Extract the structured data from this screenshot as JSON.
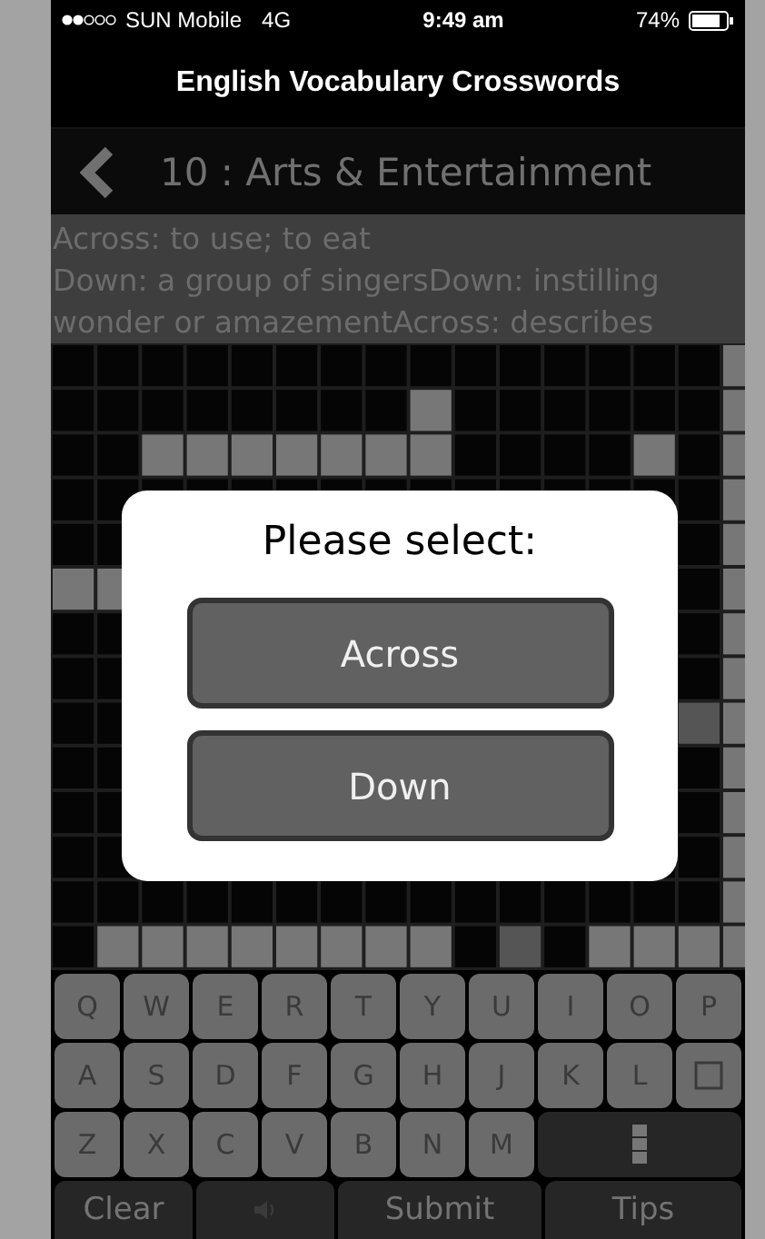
{
  "status_bar": {
    "carrier": "SUN Mobile",
    "network": "4G",
    "time": "9:49 am",
    "battery": "74%"
  },
  "app_title": "English Vocabulary Crosswords",
  "nav": {
    "title": "10 : Arts & Entertainment"
  },
  "clues": [
    "Across: to use; to eat",
    "Down: a group of singersDown: instilling wonder or amazementAcross: describes"
  ],
  "dialog": {
    "title": "Please select:",
    "options": [
      {
        "label": "Across"
      },
      {
        "label": "Down"
      }
    ]
  },
  "keyboard": {
    "rows": [
      [
        {
          "kind": "letter",
          "label": "Q"
        },
        {
          "kind": "letter",
          "label": "W"
        },
        {
          "kind": "letter",
          "label": "E"
        },
        {
          "kind": "letter",
          "label": "R"
        },
        {
          "kind": "letter",
          "label": "T"
        },
        {
          "kind": "letter",
          "label": "Y"
        },
        {
          "kind": "letter",
          "label": "U"
        },
        {
          "kind": "letter",
          "label": "I"
        },
        {
          "kind": "letter",
          "label": "O"
        },
        {
          "kind": "letter",
          "label": "P"
        }
      ],
      [
        {
          "kind": "letter",
          "label": "A"
        },
        {
          "kind": "letter",
          "label": "S"
        },
        {
          "kind": "letter",
          "label": "D"
        },
        {
          "kind": "letter",
          "label": "F"
        },
        {
          "kind": "letter",
          "label": "G"
        },
        {
          "kind": "letter",
          "label": "H"
        },
        {
          "kind": "letter",
          "label": "J"
        },
        {
          "kind": "letter",
          "label": "K"
        },
        {
          "kind": "letter",
          "label": "L"
        },
        {
          "kind": "square"
        }
      ],
      [
        {
          "kind": "letter",
          "label": "Z"
        },
        {
          "kind": "letter",
          "label": "X"
        },
        {
          "kind": "letter",
          "label": "C"
        },
        {
          "kind": "letter",
          "label": "V"
        },
        {
          "kind": "letter",
          "label": "B"
        },
        {
          "kind": "letter",
          "label": "N"
        },
        {
          "kind": "letter",
          "label": "M"
        },
        {
          "kind": "column"
        }
      ]
    ]
  },
  "toolbar": [
    {
      "kind": "text",
      "label": "Clear"
    },
    {
      "kind": "speaker",
      "disabled": true
    },
    {
      "kind": "text",
      "label": "Submit"
    },
    {
      "kind": "text",
      "label": "Tips"
    }
  ]
}
